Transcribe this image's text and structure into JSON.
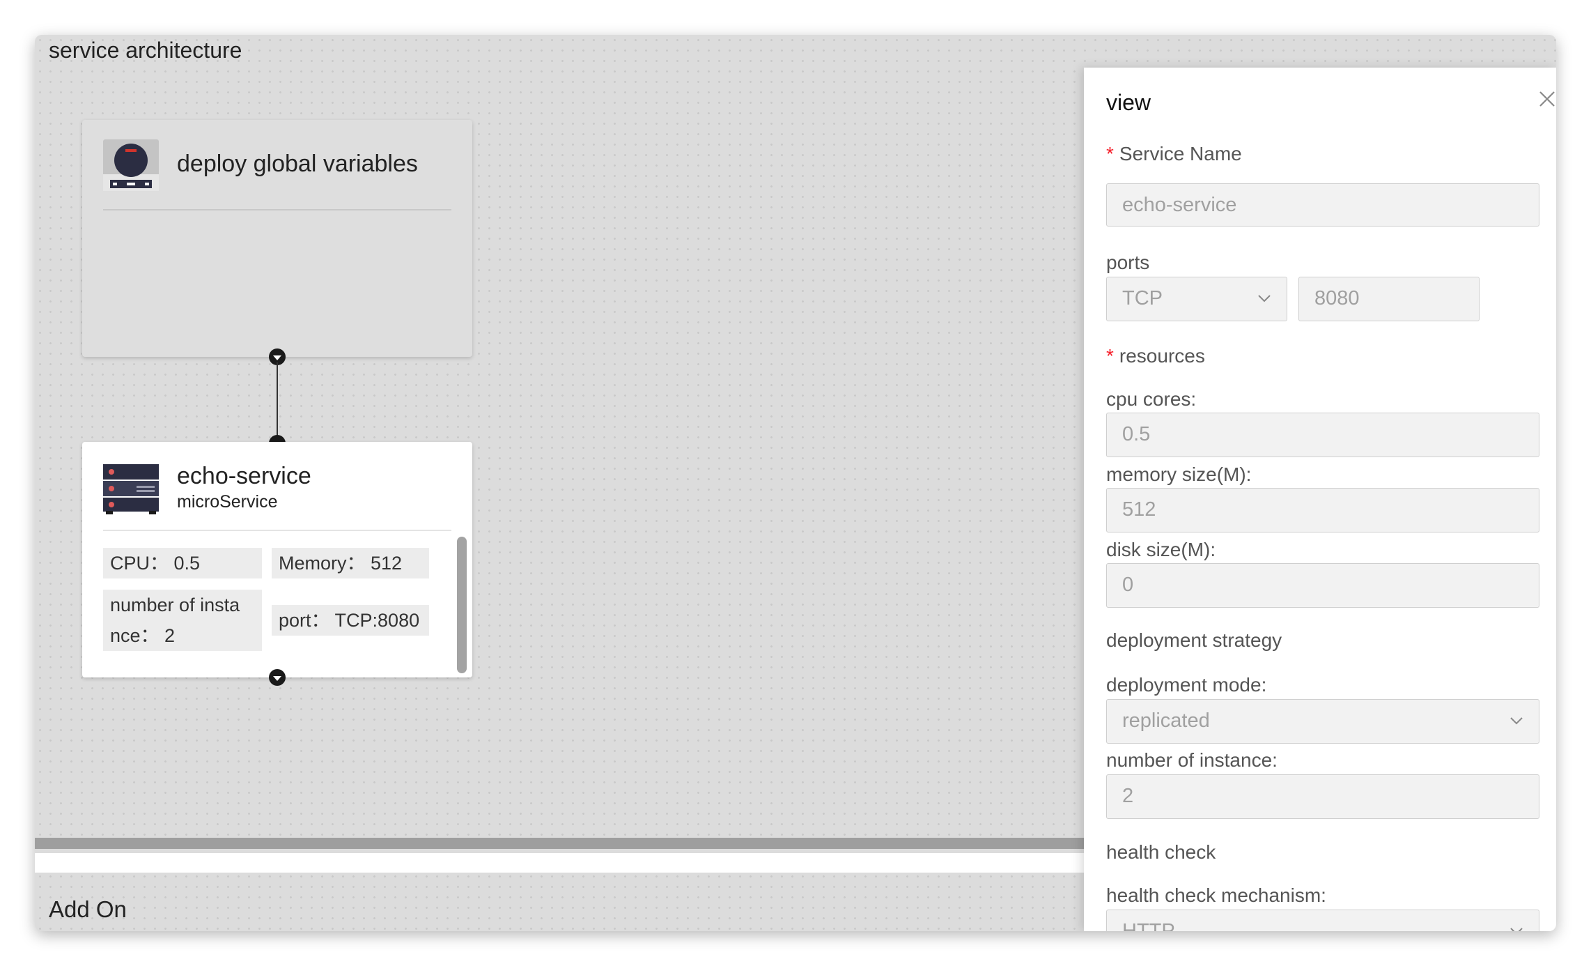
{
  "canvas": {
    "section_title": "service architecture",
    "addon_title": "Add On",
    "cards": {
      "global": {
        "title": "deploy global variables"
      },
      "service": {
        "title": "echo-service",
        "subtitle": "microService",
        "stats": {
          "cpu": "CPU： 0.5",
          "memory": "Memory： 512",
          "instances_line1": "number of insta",
          "instances_line2": "nce： 2",
          "port": "port： TCP:8080"
        }
      }
    }
  },
  "panel": {
    "title": "view",
    "required_mark": "*",
    "service_name": {
      "label": "Service Name",
      "value": "echo-service"
    },
    "ports": {
      "label": "ports",
      "protocol": "TCP",
      "port": "8080"
    },
    "resources": {
      "label": "resources",
      "cpu": {
        "label": "cpu cores:",
        "value": "0.5"
      },
      "memory": {
        "label": "memory size(M):",
        "value": "512"
      },
      "disk": {
        "label": "disk size(M):",
        "value": "0"
      }
    },
    "deployment": {
      "label": "deployment strategy",
      "mode": {
        "label": "deployment mode:",
        "value": "replicated"
      },
      "instances": {
        "label": "number of instance:",
        "value": "2"
      }
    },
    "health": {
      "label": "health check",
      "mechanism": {
        "label": "health check mechanism:",
        "value": "HTTP"
      }
    }
  },
  "colors": {
    "canvas_bg": "#dcdcdc",
    "required": "#f5222d",
    "input_bg": "#f2f2f2",
    "input_text": "#a0a0a0"
  },
  "icons": [
    "server-console-icon",
    "server-rack-icon",
    "close-icon",
    "chevron-down-icon"
  ]
}
